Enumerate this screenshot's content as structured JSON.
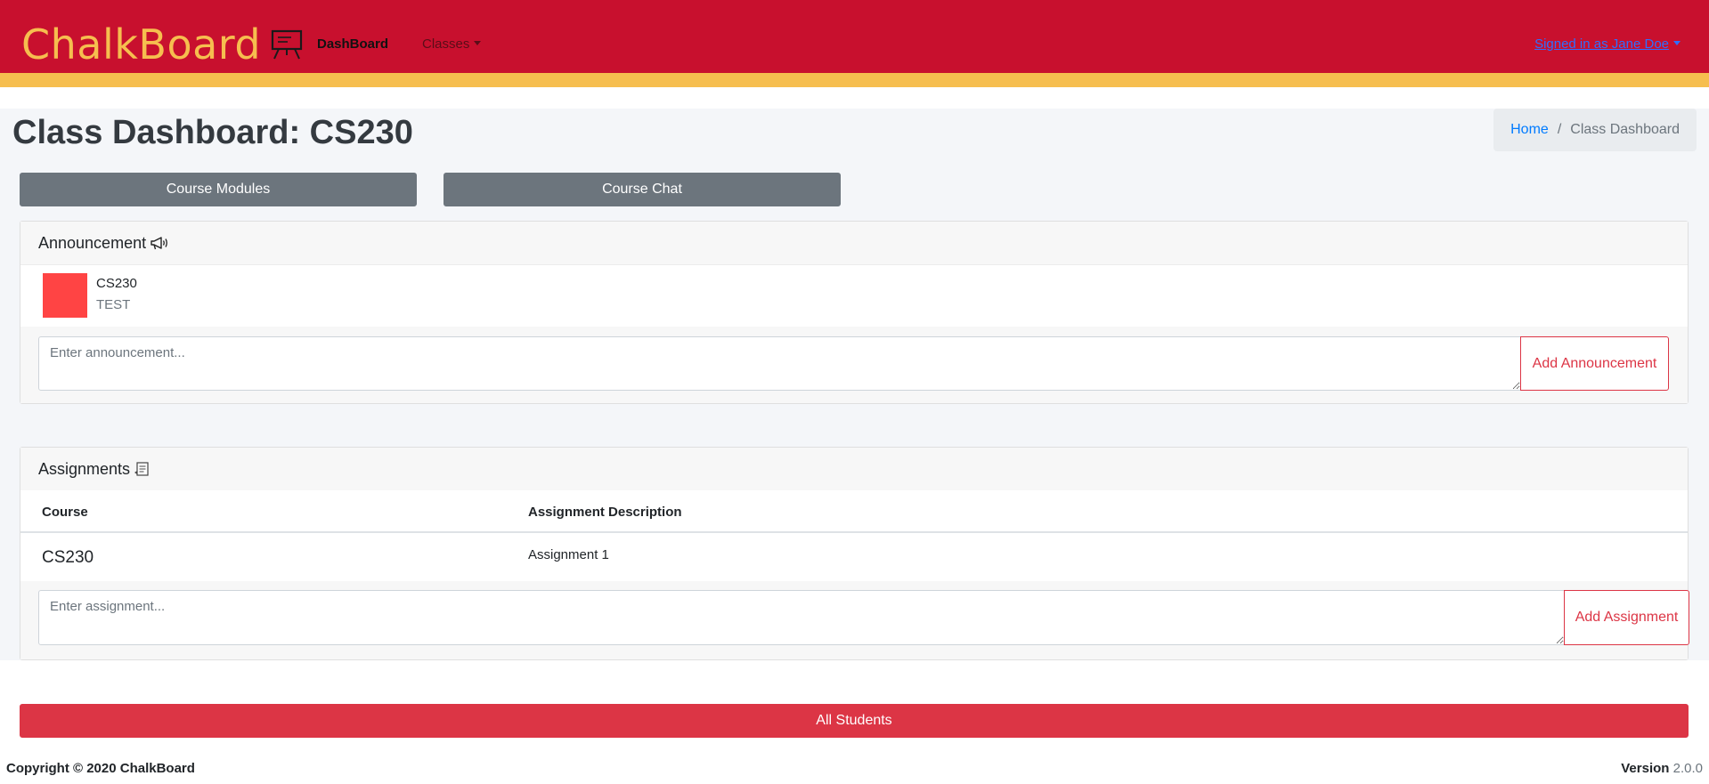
{
  "navbar": {
    "brand": "ChalkBoard",
    "dashboard_label": "DashBoard",
    "classes_label": "Classes",
    "user_label": "Signed in as Jane Doe"
  },
  "page": {
    "title": "Class Dashboard: CS230",
    "breadcrumb": {
      "home": "Home",
      "separator": "/",
      "current": "Class Dashboard"
    }
  },
  "actions": {
    "modules_label": "Course Modules",
    "chat_label": "Course Chat"
  },
  "announcements": {
    "header": "Announcement",
    "items": [
      {
        "course": "CS230",
        "message": "TEST",
        "color": "#ff4444"
      }
    ],
    "input_placeholder": "Enter announcement...",
    "add_label": "Add Announcement"
  },
  "assignments": {
    "header": "Assignments",
    "columns": [
      "Course",
      "Assignment Description"
    ],
    "rows": [
      {
        "course": "CS230",
        "description": "Assignment 1"
      }
    ],
    "input_placeholder": "Enter assignment...",
    "add_label": "Add Assignment"
  },
  "all_students_label": "All Students",
  "footer": {
    "copyright": "Copyright © 2020 ChalkBoard",
    "version_label": "Version",
    "version": "2.0.0"
  },
  "colors": {
    "primary_red": "#c8102e",
    "accent_gold": "#f6be4f",
    "danger": "#dc3545",
    "secondary": "#6c757d",
    "link_blue": "#007bff"
  }
}
